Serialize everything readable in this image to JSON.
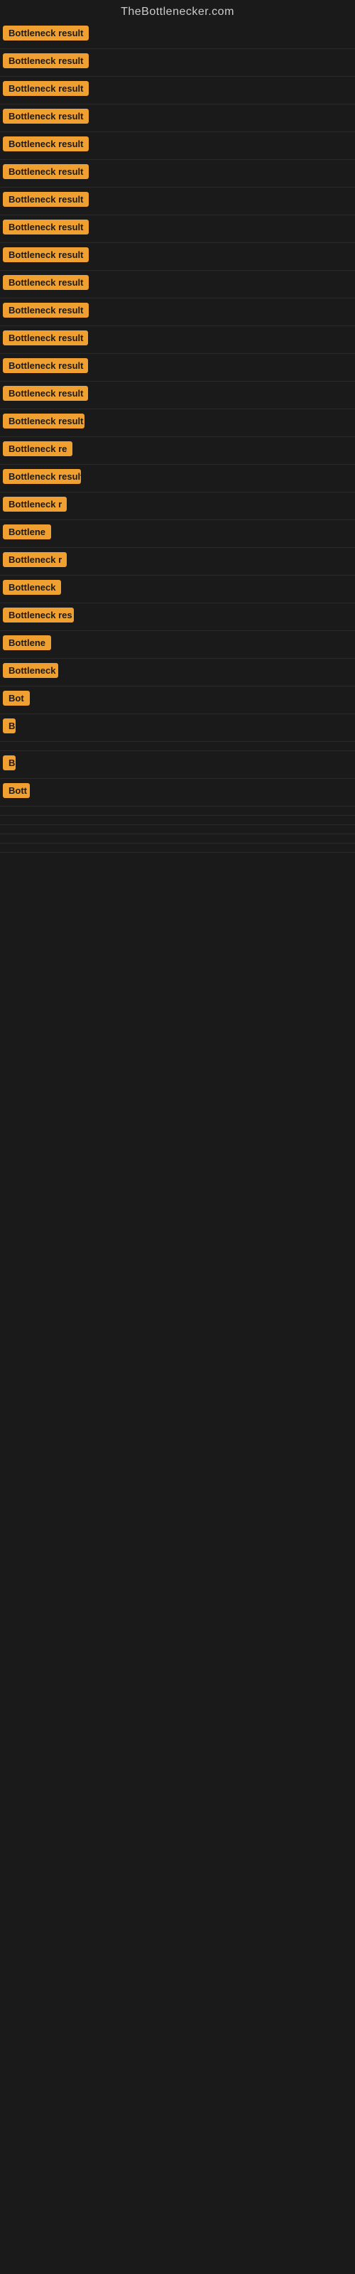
{
  "site": {
    "title": "TheBottlenecker.com"
  },
  "results": [
    {
      "id": 1,
      "label": "Bottleneck result",
      "width": 140
    },
    {
      "id": 2,
      "label": "Bottleneck result",
      "width": 140
    },
    {
      "id": 3,
      "label": "Bottleneck result",
      "width": 140
    },
    {
      "id": 4,
      "label": "Bottleneck result",
      "width": 140
    },
    {
      "id": 5,
      "label": "Bottleneck result",
      "width": 140
    },
    {
      "id": 6,
      "label": "Bottleneck result",
      "width": 140
    },
    {
      "id": 7,
      "label": "Bottleneck result",
      "width": 140
    },
    {
      "id": 8,
      "label": "Bottleneck result",
      "width": 130
    },
    {
      "id": 9,
      "label": "Bottleneck result",
      "width": 130
    },
    {
      "id": 10,
      "label": "Bottleneck result",
      "width": 130
    },
    {
      "id": 11,
      "label": "Bottleneck result",
      "width": 130
    },
    {
      "id": 12,
      "label": "Bottleneck result",
      "width": 120
    },
    {
      "id": 13,
      "label": "Bottleneck result",
      "width": 120
    },
    {
      "id": 14,
      "label": "Bottleneck result",
      "width": 120
    },
    {
      "id": 15,
      "label": "Bottleneck result",
      "width": 115
    },
    {
      "id": 16,
      "label": "Bottleneck re",
      "width": 100
    },
    {
      "id": 17,
      "label": "Bottleneck result",
      "width": 110
    },
    {
      "id": 18,
      "label": "Bottleneck r",
      "width": 90
    },
    {
      "id": 19,
      "label": "Bottlene",
      "width": 75
    },
    {
      "id": 20,
      "label": "Bottleneck r",
      "width": 90
    },
    {
      "id": 21,
      "label": "Bottleneck",
      "width": 82
    },
    {
      "id": 22,
      "label": "Bottleneck res",
      "width": 100
    },
    {
      "id": 23,
      "label": "Bottlene",
      "width": 70
    },
    {
      "id": 24,
      "label": "Bottleneck",
      "width": 78
    },
    {
      "id": 25,
      "label": "Bot",
      "width": 40
    },
    {
      "id": 26,
      "label": "B",
      "width": 18
    },
    {
      "id": 27,
      "label": "",
      "width": 0
    },
    {
      "id": 28,
      "label": "B",
      "width": 18
    },
    {
      "id": 29,
      "label": "Bott",
      "width": 38
    },
    {
      "id": 30,
      "label": "",
      "width": 0
    },
    {
      "id": 31,
      "label": "",
      "width": 0
    },
    {
      "id": 32,
      "label": "",
      "width": 0
    },
    {
      "id": 33,
      "label": "",
      "width": 0
    },
    {
      "id": 34,
      "label": "",
      "width": 0
    }
  ]
}
